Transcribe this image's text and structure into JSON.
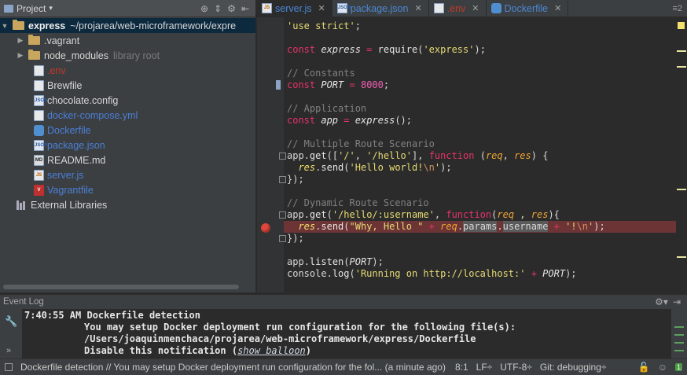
{
  "project_panel": {
    "title": "Project",
    "root": {
      "name": "express",
      "path": "~/projarea/web-microframework/expre"
    },
    "items": [
      {
        "name": ".vagrant",
        "kind": "folder",
        "note": ""
      },
      {
        "name": "node_modules",
        "kind": "folder",
        "note": "library root"
      },
      {
        "name": ".env",
        "kind": "file",
        "note": ""
      },
      {
        "name": "Brewfile",
        "kind": "file",
        "note": ""
      },
      {
        "name": "chocolate.config",
        "kind": "json",
        "note": ""
      },
      {
        "name": "docker-compose.yml",
        "kind": "yml",
        "note": ""
      },
      {
        "name": "Dockerfile",
        "kind": "docker",
        "note": ""
      },
      {
        "name": "package.json",
        "kind": "json",
        "note": ""
      },
      {
        "name": "README.md",
        "kind": "md",
        "note": ""
      },
      {
        "name": "server.js",
        "kind": "js",
        "note": ""
      },
      {
        "name": "Vagrantfile",
        "kind": "vagrant",
        "note": ""
      }
    ],
    "external": "External Libraries"
  },
  "tabs": [
    {
      "label": "server.js",
      "icon": "js-file-icon"
    },
    {
      "label": "package.json",
      "icon": "json-file-icon"
    },
    {
      "label": ".env",
      "icon": "file-icon"
    },
    {
      "label": "Dockerfile",
      "icon": "docker-icon"
    }
  ],
  "tab_overflow": "≡2",
  "code": {
    "l1": "'use strict'",
    "l3_kw": "const",
    "l3_var": "express",
    "l3_fn": "require",
    "l3_str": "'express'",
    "c_constants": "// Constants",
    "port_kw": "const",
    "port_var": "PORT",
    "port_num": "8000",
    "c_app": "// Application",
    "app_kw": "const",
    "app_var": "app",
    "app_fn": "express",
    "c_multi": "// Multiple Route Scenario",
    "get1_obj": "app",
    "get1_fn": "get",
    "get1_s1": "'/'",
    "get1_s2": "'/hello'",
    "get1_kw": "function",
    "get1_p1": "req",
    "get1_p2": "res",
    "send1_obj": "res",
    "send1_fn": "send",
    "send1_str": "'Hello world!",
    "send1_esc": "\\n",
    "send1_end": "'",
    "c_dynamic": "// Dynamic Route Scenario",
    "get2_s": "'/hello/:username'",
    "send2_str": "\"Why, Hello \"",
    "send2_params": "params",
    "send2_user": "username",
    "send2_tail_str": "'!",
    "listen_fn": "listen",
    "console": "console",
    "log_fn": "log",
    "log_str": "'Running on http://localhost:'"
  },
  "event_log": {
    "title": "Event Log",
    "time": "7:40:55 AM",
    "head": "Dockerfile detection",
    "line2": "You may setup Docker deployment run configuration for the following file(s):",
    "line3": "/Users/joaquinmenchaca/projarea/web-microframework/express/Dockerfile",
    "line4_pre": "Disable this notification (",
    "line4_link": "show balloon",
    "line4_post": ")"
  },
  "status_bar": {
    "message": "Dockerfile detection  // You may setup Docker deployment run configuration for the fol... (a minute ago)",
    "position": "8:1",
    "line_sep": "LF÷",
    "encoding": "UTF-8÷",
    "vcs": "Git: debugging÷",
    "badge": "1"
  }
}
